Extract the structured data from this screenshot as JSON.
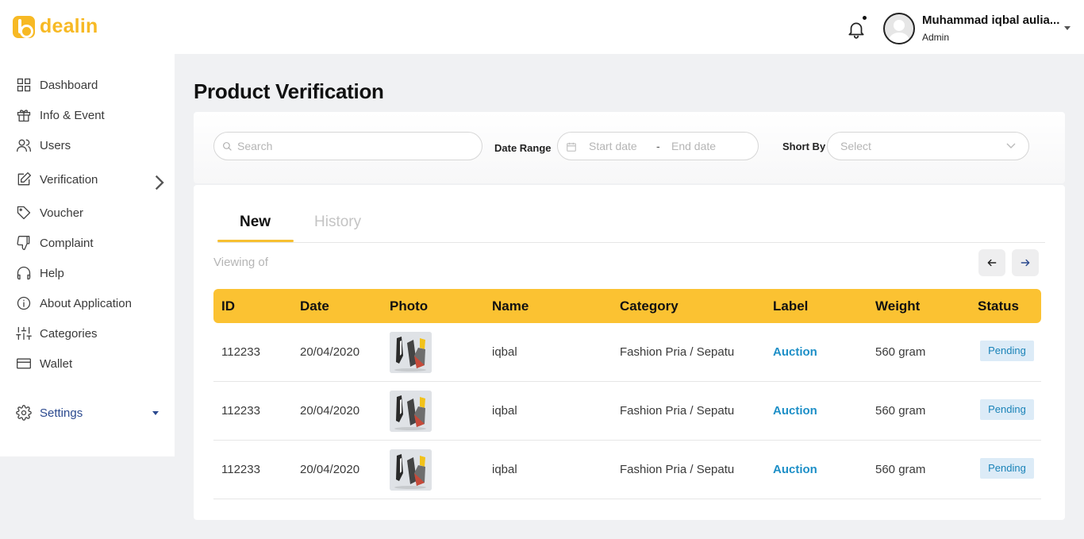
{
  "brand": {
    "name": "dealin",
    "color": "#f7b924"
  },
  "header": {
    "notification_icon": "bell-icon",
    "user_name": "Muhammad iqbal aulia...",
    "user_role": "Admin"
  },
  "sidebar": {
    "items": [
      {
        "label": "Dashboard",
        "icon": "grid-icon"
      },
      {
        "label": "Info & Event",
        "icon": "gift-icon"
      },
      {
        "label": "Users",
        "icon": "users-icon"
      },
      {
        "label": "Verification",
        "icon": "edit-icon"
      },
      {
        "label": "Voucher",
        "icon": "tag-icon"
      },
      {
        "label": "Complaint",
        "icon": "thumbs-down-icon"
      },
      {
        "label": "Help",
        "icon": "headphones-icon"
      },
      {
        "label": "About Application",
        "icon": "info-icon"
      },
      {
        "label": "Categories",
        "icon": "sliders-icon"
      },
      {
        "label": "Wallet",
        "icon": "wallet-icon"
      },
      {
        "label": "Settings",
        "icon": "gear-icon"
      }
    ]
  },
  "page": {
    "title": "Product Verification"
  },
  "filters": {
    "search_placeholder": "Search",
    "date_range_label": "Date Range",
    "start_placeholder": "Start date",
    "separator": "-",
    "end_placeholder": "End date",
    "sort_label": "Short By",
    "sort_value": "Select"
  },
  "tabs": {
    "active": "New",
    "inactive": "History"
  },
  "viewing": "Viewing of",
  "table": {
    "headers": [
      "ID",
      "Date",
      "Photo",
      "Name",
      "Category",
      "Label",
      "Weight",
      "Status"
    ],
    "rows": [
      {
        "id": "112233",
        "date": "20/04/2020",
        "name": "iqbal",
        "category": "Fashion Pria / Sepatu",
        "label": "Auction",
        "weight": "560 gram",
        "status": "Pending"
      },
      {
        "id": "112233",
        "date": "20/04/2020",
        "name": "iqbal",
        "category": "Fashion Pria / Sepatu",
        "label": "Auction",
        "weight": "560 gram",
        "status": "Pending"
      },
      {
        "id": "112233",
        "date": "20/04/2020",
        "name": "iqbal",
        "category": "Fashion Pria / Sepatu",
        "label": "Auction",
        "weight": "560 gram",
        "status": "Pending"
      }
    ]
  },
  "colors": {
    "accent": "#fbc232",
    "link": "#1d8fc7",
    "status_bg": "#dcebf7",
    "settings": "#2c4a8f"
  }
}
